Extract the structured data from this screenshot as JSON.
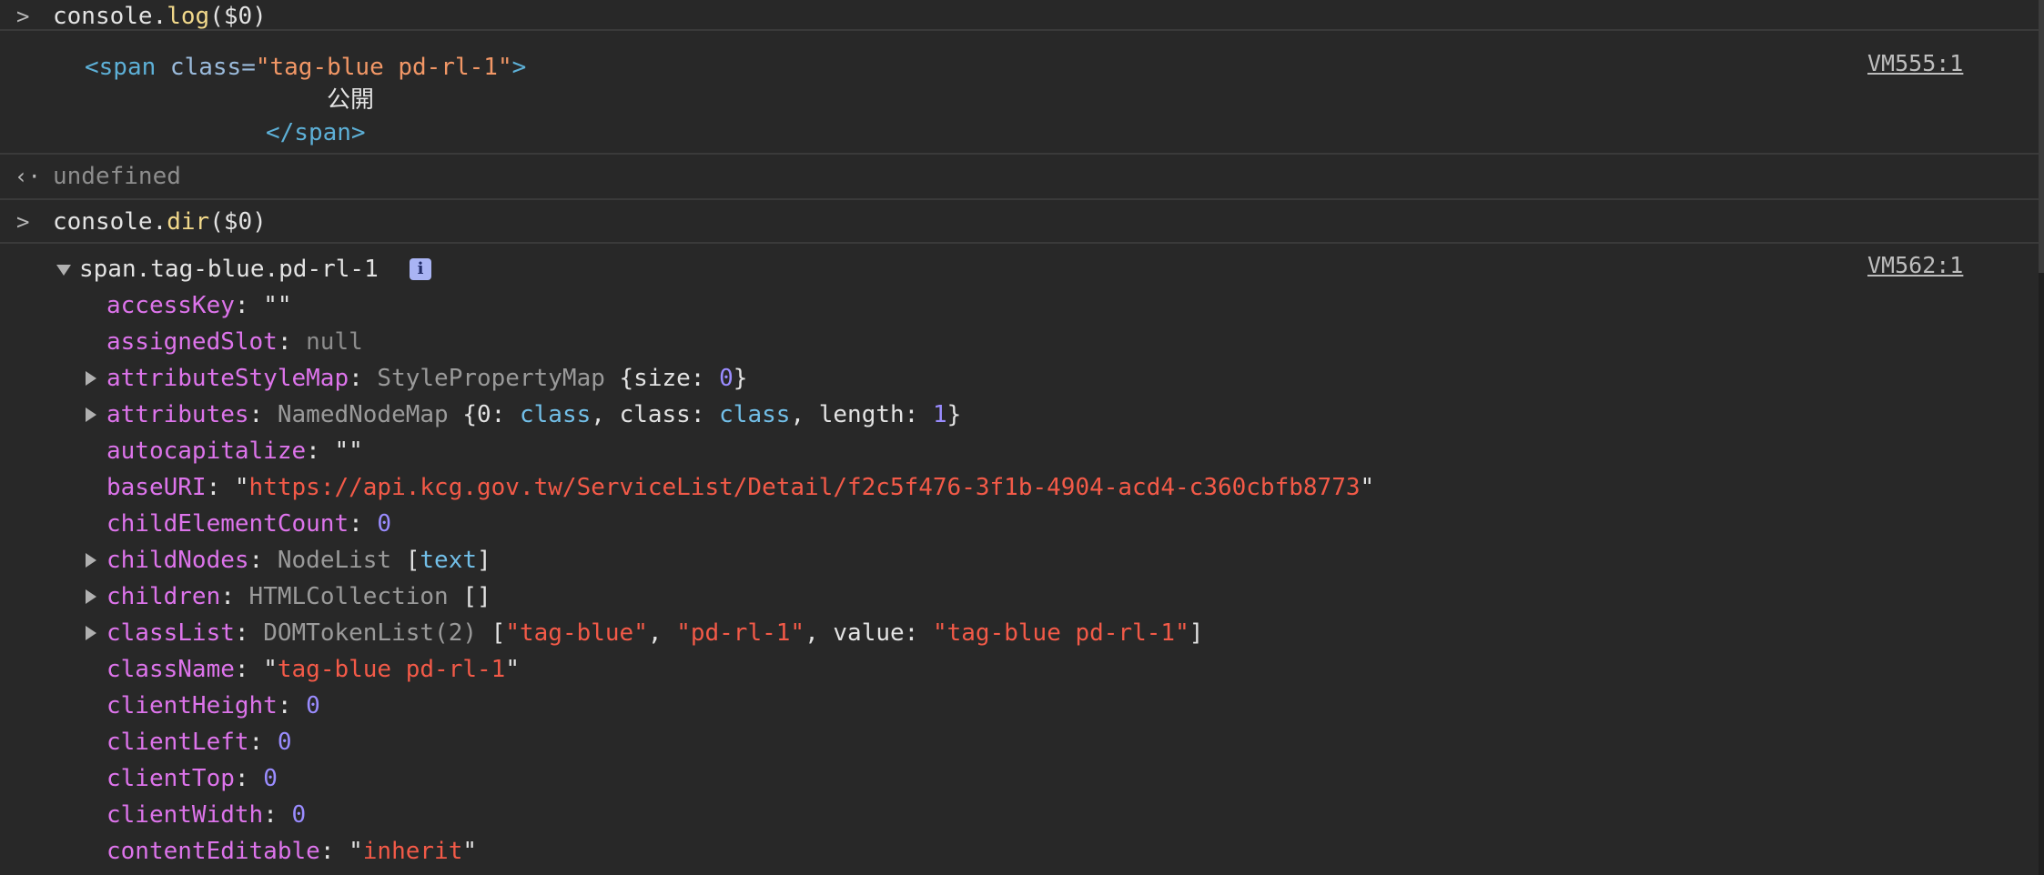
{
  "entries": {
    "log_cmd": {
      "prompt_icon": "chevron-right-icon",
      "obj": "console.",
      "fn": "log",
      "args": "($0)"
    },
    "log_output": {
      "tag_open_1": "<span ",
      "attr_name": "class=",
      "attr_value": "\"tag-blue pd-rl-1\"",
      "tag_open_2": ">",
      "text": "公開",
      "tag_close": "</span>",
      "source": "VM555:1"
    },
    "log_result": {
      "icon": "return-arrow-icon",
      "text": "undefined"
    },
    "dir_cmd": {
      "prompt_icon": "chevron-right-icon",
      "obj": "console.",
      "fn": "dir",
      "args": "($0)"
    },
    "dir_output": {
      "header": "span.tag-blue.pd-rl-1",
      "info_icon": "i",
      "source": "VM562:1"
    }
  },
  "properties": {
    "accessKey": {
      "key": "accessKey",
      "sep": ": ",
      "value": "\"\""
    },
    "assignedSlot": {
      "key": "assignedSlot",
      "sep": ": ",
      "value": "null"
    },
    "attributeStyleMap": {
      "key": "attributeStyleMap",
      "sep": ": ",
      "type": "StylePropertyMap",
      "open": " {size: ",
      "num": "0",
      "close": "}"
    },
    "attributes": {
      "key": "attributes",
      "sep": ": ",
      "type": "NamedNodeMap",
      "p1": " {0: ",
      "v1": "class",
      "p2": ", class: ",
      "v2": "class",
      "p3": ", length: ",
      "num": "1",
      "close": "}"
    },
    "autocapitalize": {
      "key": "autocapitalize",
      "sep": ": ",
      "value": "\"\""
    },
    "baseURI": {
      "key": "baseURI",
      "sep": ": ",
      "q1": "\"",
      "value": "https://api.kcg.gov.tw/ServiceList/Detail/f2c5f476-3f1b-4904-acd4-c360cbfb8773",
      "q2": "\""
    },
    "childElementCount": {
      "key": "childElementCount",
      "sep": ": ",
      "num": "0"
    },
    "childNodes": {
      "key": "childNodes",
      "sep": ": ",
      "type": "NodeList",
      "open": " [",
      "item": "text",
      "close": "]"
    },
    "children": {
      "key": "children",
      "sep": ": ",
      "type": "HTMLCollection",
      "value": " []"
    },
    "classList": {
      "key": "classList",
      "sep": ": ",
      "type": "DOMTokenList(2)",
      "open": " [",
      "s1": "\"tag-blue\"",
      "comma": ", ",
      "s2": "\"pd-rl-1\"",
      "vlabel": ", value: ",
      "s3": "\"tag-blue pd-rl-1\"",
      "close": "]"
    },
    "className": {
      "key": "className",
      "sep": ": ",
      "q1": "\"",
      "value": "tag-blue pd-rl-1",
      "q2": "\""
    },
    "clientHeight": {
      "key": "clientHeight",
      "sep": ": ",
      "num": "0"
    },
    "clientLeft": {
      "key": "clientLeft",
      "sep": ": ",
      "num": "0"
    },
    "clientTop": {
      "key": "clientTop",
      "sep": ": ",
      "num": "0"
    },
    "clientWidth": {
      "key": "clientWidth",
      "sep": ": ",
      "num": "0"
    },
    "contentEditable": {
      "key": "contentEditable",
      "sep": ": ",
      "q1": "\"",
      "value": "inherit",
      "q2": "\""
    }
  },
  "colors": {
    "background": "#282828",
    "property_key": "#dd74eb",
    "number": "#9a8cff",
    "string": "#f35a48",
    "type_name": "#9a9a9a",
    "function_name": "#f2d98b"
  }
}
